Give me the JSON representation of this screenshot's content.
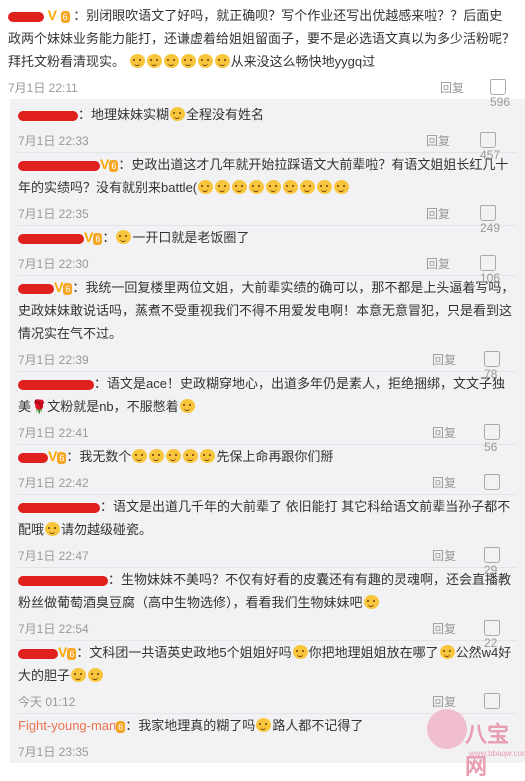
{
  "top": {
    "pre": "：别闭眼吹语文了好吗，就正确呗？写个作业还写出优越感来啦？？后面史政两个妹妹业务能力能打，还谦虚着给姐姐留面子，要不是必选语文真以为多少活粉呢？拜托文粉看清现实。",
    "post": "从来没这么畅快地yygq过",
    "time": "7月1日 22:11",
    "reply": "回复",
    "likes": "596"
  },
  "replies": [
    {
      "name": "",
      "text": "：地理妹妹实糊",
      "text2": "全程没有姓名",
      "time": "7月1日 22:33",
      "reply": "回复",
      "likes": "457"
    },
    {
      "name": "",
      "text": "：史政出道这才几年就开始拉踩语文大前辈啦？有语文姐姐长红几十年的实绩吗？没有就别来battle(",
      "text2": "",
      "time": "7月1日 22:35",
      "reply": "回复",
      "likes": "249"
    },
    {
      "name": "",
      "text": "：",
      "text2": "一开口就是老饭圈了",
      "time": "7月1日 22:30",
      "reply": "回复",
      "likes": "106"
    },
    {
      "name": "",
      "text": "：我统一回复楼里两位文姐，大前辈实绩的确可以，那不都是上头逼着写吗，史政妹妹敢说话吗，蒸煮不受重视我们不得不用爱发电啊！本意无意冒犯，只是看到这情况实在气不过。",
      "text2": "",
      "time": "7月1日 22:39",
      "reply": "回复",
      "likes": "78"
    },
    {
      "name": "",
      "text": "：语文是ace！史政糊穿地心，出道多年仍是素人，拒绝捆绑，文文子独美",
      "text2": "文粉就是nb，不服憋着",
      "time": "7月1日 22:41",
      "reply": "回复",
      "likes": "56"
    },
    {
      "name": "",
      "text": "：我无数个",
      "text2": "先保上命再跟你们掰",
      "time": "7月1日 22:42",
      "reply": "回复",
      "likes": ""
    },
    {
      "name": "",
      "text": "：语文是出道几千年的大前辈了 依旧能打 其它科给语文前辈当孙子都不配哦",
      "text2": "请勿越级碰瓷。",
      "time": "7月1日 22:47",
      "reply": "回复",
      "likes": "29"
    },
    {
      "name": "",
      "text": "：生物妹妹不美吗？不仅有好看的皮囊还有有趣的灵魂啊，还会直播教粉丝做葡萄酒臭豆腐（高中生物选修），看看我们生物妹妹吧",
      "text2": "",
      "time": "7月1日 22:54",
      "reply": "回复",
      "likes": "22"
    },
    {
      "name": "",
      "text": "：文科团一共语英史政地5个姐姐好吗",
      "text2": "你把地理姐姐放在哪了",
      "text3": "公然w4好大的胆子",
      "time": "今天 01:12",
      "reply": "回复",
      "likes": ""
    },
    {
      "name": "Fight-young-man",
      "text": "：我家地理真的糊了吗",
      "text2": "路人都不记得了",
      "time": "7月1日 23:35",
      "reply": "",
      "likes": ""
    }
  ],
  "watermark": {
    "brand": "八宝网",
    "url": "www.bbaqw.com"
  }
}
